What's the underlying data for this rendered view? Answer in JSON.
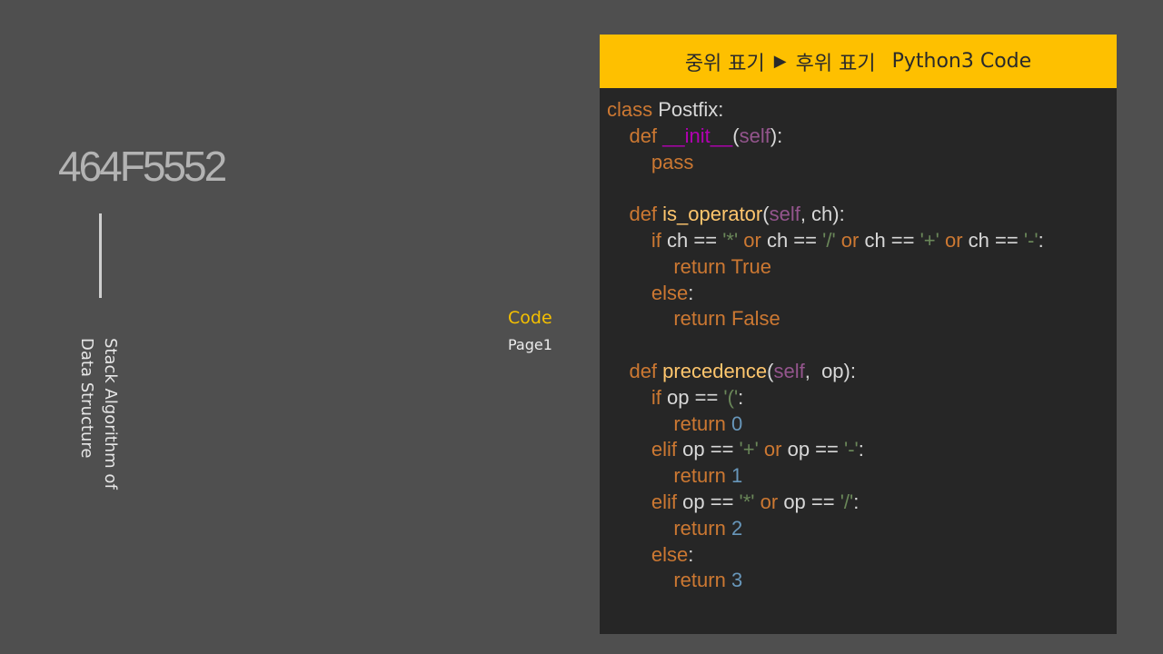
{
  "slide": {
    "id_text": "464F5552",
    "vertical_title": "Stack Algorithm of\nData Structure"
  },
  "nav": {
    "section": "Code",
    "page": "Page1"
  },
  "panel": {
    "header_title": "중위 표기",
    "header_arrow": "▶",
    "header_title2": "후위 표기",
    "header_lang": "Python3 Code"
  },
  "code_lines": [
    "class Postfix:",
    "    def __init__(self):",
    "        pass",
    "",
    "    def is_operator(self, ch):",
    "        if ch == '*' or ch == '/' or ch == '+' or ch == '-':",
    "            return True",
    "        else:",
    "            return False",
    "",
    "    def precedence(self,  op):",
    "        if op == '(':",
    "            return 0",
    "        elif op == '+' or op == '-':",
    "            return 1",
    "        elif op == '*' or op == '/':",
    "            return 2",
    "        else:",
    "            return 3"
  ],
  "colors": {
    "background": "#4f4f4f",
    "panel": "#262626",
    "header": "#fec000",
    "accent": "#f5c000",
    "keyword": "#cc7832",
    "function": "#ffc66d",
    "self": "#94558d",
    "magic": "#b200b2",
    "string": "#6a8759",
    "number": "#6897bb"
  }
}
